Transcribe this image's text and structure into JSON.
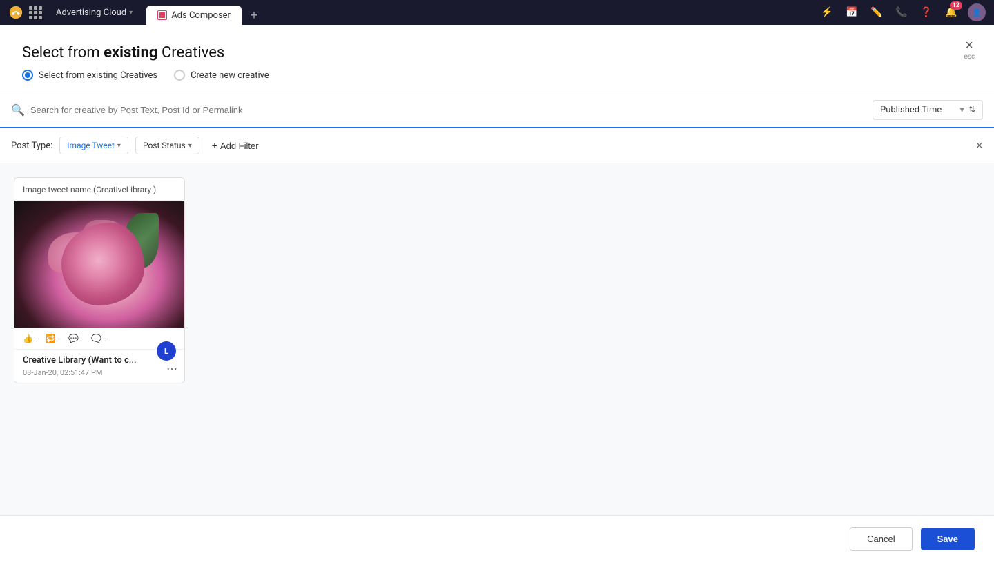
{
  "topnav": {
    "app_name": "Advertising Cloud",
    "tab_label": "Ads Composer",
    "add_tab_label": "+"
  },
  "dialog": {
    "title_prefix": "Select from ",
    "title_highlight": "existing",
    "title_suffix": " Creatives",
    "option_existing": "Select from existing Creatives",
    "option_new": "Create new creative",
    "close_label": "×",
    "close_esc": "esc"
  },
  "search": {
    "placeholder": "Search for creative by Post Text, Post Id or Permalink",
    "sort_label": "Published Time"
  },
  "filters": {
    "post_type_label": "Post Type:",
    "post_type_value": "Image Tweet",
    "post_status_label": "Post Status",
    "add_filter_label": "Add Filter"
  },
  "card": {
    "title": "Image tweet name (CreativeLibrary )",
    "like_count": "-",
    "retweet_count": "-",
    "comment_count": "-",
    "mention_count": "-",
    "badge_letter": "L",
    "name": "Creative Library (Want to c...",
    "date": "08-Jan-20, 02:51:47 PM"
  },
  "footer": {
    "cancel_label": "Cancel",
    "save_label": "Save"
  }
}
